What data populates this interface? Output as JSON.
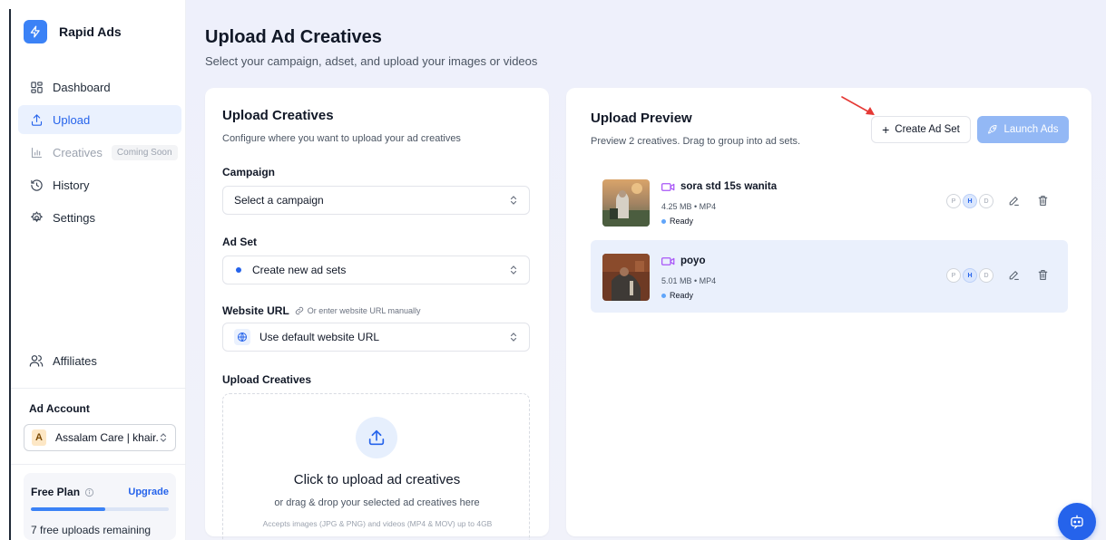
{
  "brand": {
    "name": "Rapid Ads"
  },
  "nav": {
    "dashboard": "Dashboard",
    "upload": "Upload",
    "creatives": "Creatives",
    "creatives_badge": "Coming Soon",
    "history": "History",
    "settings": "Settings",
    "affiliates": "Affiliates"
  },
  "ad_account": {
    "title": "Ad Account",
    "avatar_letter": "A",
    "selected": "Assalam Care | khair..."
  },
  "plan": {
    "name": "Free Plan",
    "upgrade": "Upgrade",
    "remaining": "7 free uploads remaining",
    "usage_fraction": 0.54
  },
  "page": {
    "title": "Upload Ad Creatives",
    "subtitle": "Select your campaign, adset, and upload your images or videos"
  },
  "upload_form": {
    "title": "Upload Creatives",
    "subtitle": "Configure where you want to upload your ad creatives",
    "campaign_label": "Campaign",
    "campaign_value": "Select a campaign",
    "adset_label": "Ad Set",
    "adset_value": "Create new ad sets",
    "website_label": "Website URL",
    "website_hint": "Or enter website URL manually",
    "website_value": "Use default website URL",
    "creatives_label": "Upload Creatives",
    "dropzone_title": "Click to upload ad creatives",
    "dropzone_sub": "or drag & drop your selected ad creatives here",
    "dropzone_accepts": "Accepts images (JPG & PNG) and videos (MP4 & MOV) up to 4GB"
  },
  "preview": {
    "title": "Upload Preview",
    "subtitle": "Preview 2 creatives. Drag to group into ad sets.",
    "create_ad_set": "Create Ad Set",
    "launch_ads": "Launch Ads",
    "items": [
      {
        "name": "sora std 15s wanita",
        "meta": "4.25 MB • MP4",
        "status": "Ready",
        "pills": [
          "P",
          "H",
          "D"
        ]
      },
      {
        "name": "poyo",
        "meta": "5.01 MB • MP4",
        "status": "Ready",
        "pills": [
          "P",
          "H",
          "D"
        ]
      }
    ]
  },
  "colors": {
    "accent": "#2563eb",
    "launch_disabled": "#93b8f5",
    "annotation_arrow": "#e53935"
  }
}
